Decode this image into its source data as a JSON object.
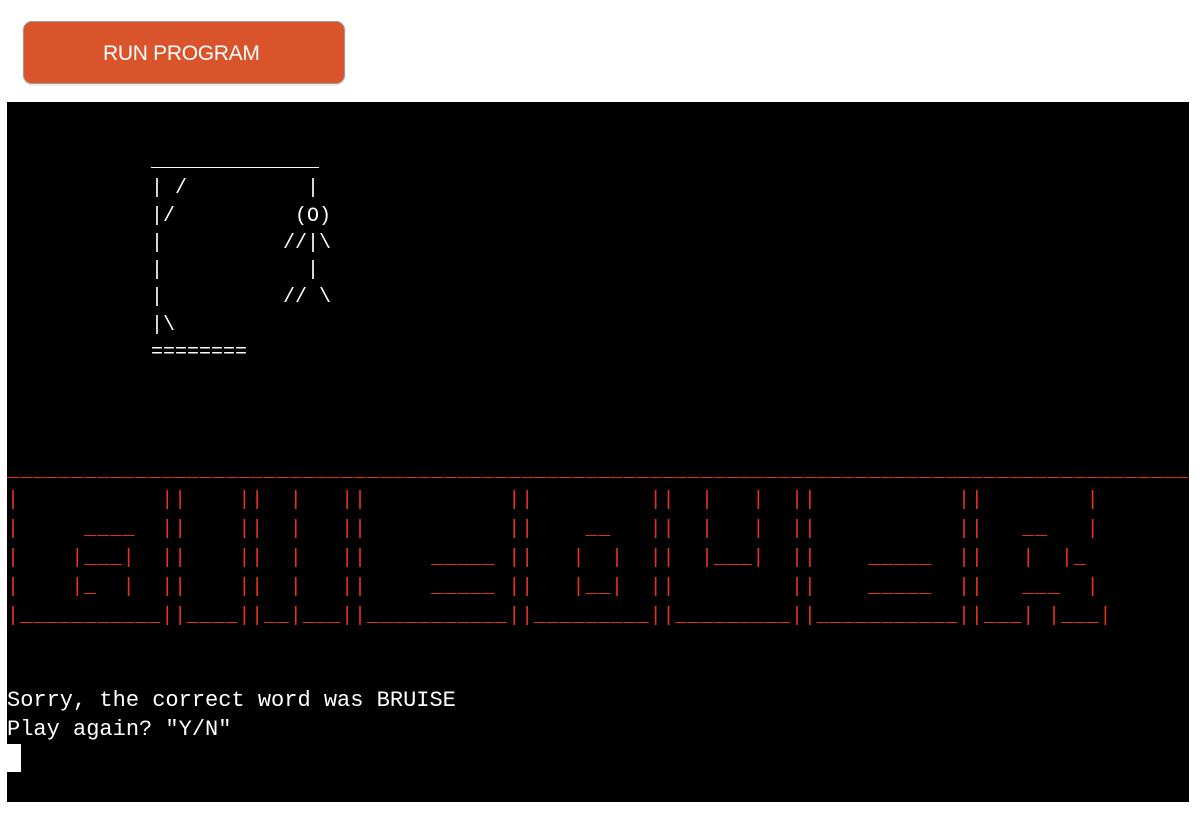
{
  "toolbar": {
    "run_label": "RUN PROGRAM",
    "run_color": "#d9532b"
  },
  "terminal": {
    "background": "#000000",
    "gallows_art": "            ______________\n            | /          |\n            |/          (O)\n            |          //|\\\n            |            |\n            |          // \\\n            |\\\n            ========",
    "banner_art": "_____________________________________________________________________________________________\n|           ||    ||  |   ||           ||         ||  |   |  ||           ||        |\n|     ____  ||    ||  |   ||           ||    __   ||  |   |  ||           ||   __   |\n|    |___|  ||    ||  |   ||     _____ ||   |  |  ||  |___|  ||    _____  ||   |  |_\n|    |_  |  ||    ||  |   ||     _____ ||   |__|  ||         ||    _____  ||   ___  |\n|___________||____||__|___||___________||_________||_________||___________||___| |___|",
    "banner_color": "#e8321f",
    "messages": [
      "Sorry, the correct word was BRUISE",
      "Play again? \"Y/N\""
    ]
  }
}
